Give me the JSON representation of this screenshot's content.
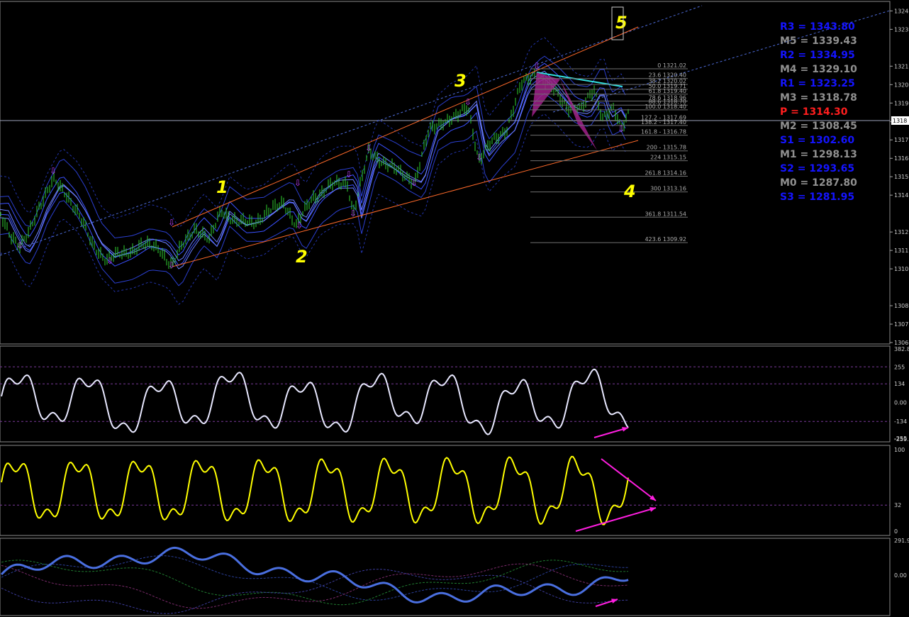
{
  "chart_data": [
    {
      "type": "candlestick",
      "price_axis": {
        "ylim": [
          1306,
          1324.4
        ],
        "ticks": [
          "1324",
          "1323",
          "1321",
          "1320",
          "1319",
          "1318",
          "1317",
          "1316",
          "1315",
          "1314",
          "1312",
          "1311",
          "1310",
          "1308",
          "1307",
          "1306"
        ],
        "current_price_label": "1318"
      },
      "wave_labels": [
        "1",
        "2",
        "3",
        "4",
        "5"
      ],
      "pivot_levels": [
        {
          "label": "R3 = 1343.80",
          "color": "#1414ff"
        },
        {
          "label": "M5 = 1339.43",
          "color": "#909090"
        },
        {
          "label": "R2 = 1334.95",
          "color": "#1414ff"
        },
        {
          "label": "M4 = 1329.10",
          "color": "#909090"
        },
        {
          "label": "R1 = 1323.25",
          "color": "#1414ff"
        },
        {
          "label": "M3 = 1318.78",
          "color": "#909090"
        },
        {
          "label": "P  = 1314.30",
          "color": "#ff1e1e"
        },
        {
          "label": "M2 = 1308.45",
          "color": "#909090"
        },
        {
          "label": "S1 = 1302.60",
          "color": "#1414ff"
        },
        {
          "label": "M1 = 1298.13",
          "color": "#909090"
        },
        {
          "label": "S2 = 1293.65",
          "color": "#1414ff"
        },
        {
          "label": "M0 = 1287.80",
          "color": "#909090"
        },
        {
          "label": "S3 = 1281.95",
          "color": "#1414ff"
        }
      ],
      "fibonacci_levels": [
        {
          "label": "0 1321.02",
          "value": 1321.02
        },
        {
          "label": "23.6 1320.40",
          "value": 1320.4
        },
        {
          "label": "38.2 1320.02",
          "value": 1320.02
        },
        {
          "label": "50.0 1319.71",
          "value": 1319.71
        },
        {
          "label": "61.8 1319.40",
          "value": 1319.4
        },
        {
          "label": "78.6 1318.96",
          "value": 1318.96
        },
        {
          "label": "88.6 1318.70",
          "value": 1318.7
        },
        {
          "label": "100.0 1318.40",
          "value": 1318.4
        },
        {
          "label": "127.2 - 1317.69",
          "value": 1317.69
        },
        {
          "label": "138.2 - 1317.40",
          "value": 1317.4
        },
        {
          "label": "161.8 - 1316.78",
          "value": 1316.78
        },
        {
          "label": "200 - 1315.78",
          "value": 1315.78
        },
        {
          "label": "224 1315.15",
          "value": 1315.15
        },
        {
          "label": "261.8 1314.16",
          "value": 1314.16
        },
        {
          "label": "300 1313.16",
          "value": 1313.16
        },
        {
          "label": "361.8 1311.54",
          "value": 1311.54
        },
        {
          "label": "423.6 1309.92",
          "value": 1309.92
        }
      ]
    },
    {
      "type": "line",
      "series": [
        {
          "color": "#e8e8ff"
        }
      ],
      "ticks": [
        "382.8",
        "255",
        "134",
        "0.00",
        "-134",
        "-255",
        "-259.4"
      ],
      "ylim": [
        -259.4,
        382.8
      ]
    },
    {
      "type": "line",
      "series": [
        {
          "color": "#ffff00"
        }
      ],
      "ticks": [
        "100",
        "32",
        "0"
      ],
      "ylim": [
        0,
        100
      ]
    },
    {
      "type": "line",
      "series": [
        {
          "color": "#4a6fe0"
        }
      ],
      "ticks": [
        "291.9",
        "0.00"
      ]
    }
  ]
}
